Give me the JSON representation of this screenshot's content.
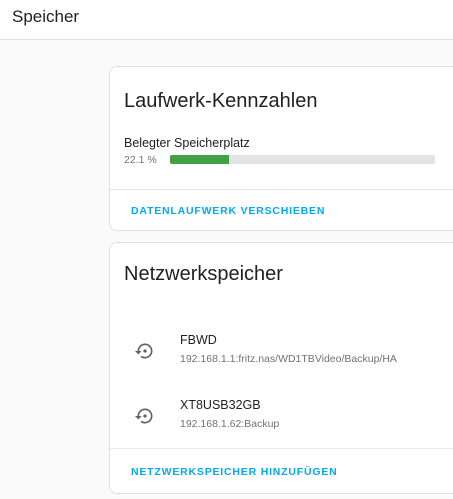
{
  "header": {
    "title": "Speicher"
  },
  "drive_card": {
    "title": "Laufwerk-Kennzahlen",
    "usage_label": "Belegter Speicherplatz",
    "usage_percent_text": "22.1 %",
    "usage_fraction": 0.221,
    "bar_color": "#43a047",
    "action_label": "DATENLAUFWERK VERSCHIEBEN"
  },
  "network_card": {
    "title": "Netzwerkspeicher",
    "shares": [
      {
        "name": "FBWD",
        "path": "192.168.1.1:fritz.nas/WD1TBVideo/Backup/HA",
        "icon": "backup-restore-icon"
      },
      {
        "name": "XT8USB32GB",
        "path": "192.168.1.62:Backup",
        "icon": "backup-restore-icon"
      }
    ],
    "action_label": "NETZWERKSPEICHER HINZUFÜGEN"
  },
  "accent_color": "#03a9f4"
}
